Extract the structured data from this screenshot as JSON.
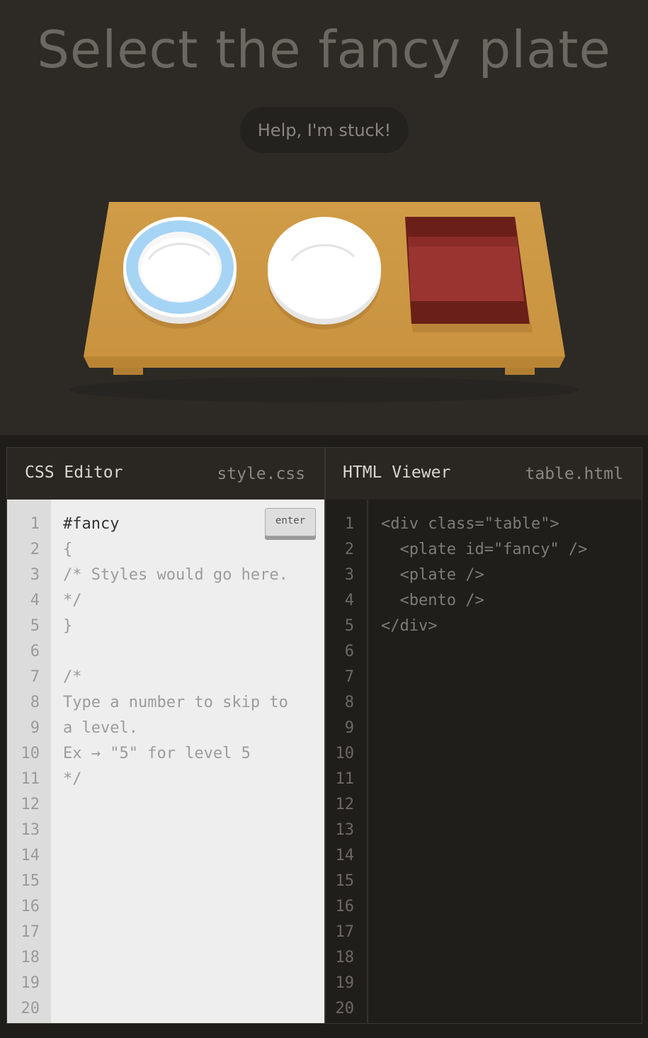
{
  "title": "Select the fancy plate",
  "help_button": "Help, I'm stuck!",
  "css_panel": {
    "title": "CSS Editor",
    "filename": "style.css",
    "enter_label": "enter",
    "input_value": "#fancy",
    "lines": [
      "{",
      "/* Styles would go here.",
      "*/",
      "}",
      "",
      "/*",
      "Type a number to skip to",
      "a level.",
      "Ex → \"5\" for level 5",
      "*/"
    ]
  },
  "html_panel": {
    "title": "HTML Viewer",
    "filename": "table.html",
    "lines": [
      "<div class=\"table\">",
      "  <plate id=\"fancy\" />",
      "  <plate />",
      "  <bento />",
      "</div>"
    ]
  },
  "line_numbers": [
    "1",
    "2",
    "3",
    "4",
    "5",
    "6",
    "7",
    "8",
    "9",
    "10",
    "11",
    "12",
    "13",
    "14",
    "15",
    "16",
    "17",
    "18",
    "19",
    "20"
  ],
  "colors": {
    "table": "#cf9a45",
    "fancy_plate_rim": "#a6d4f4",
    "plate": "#ffffff",
    "bento": "#9a3431"
  }
}
